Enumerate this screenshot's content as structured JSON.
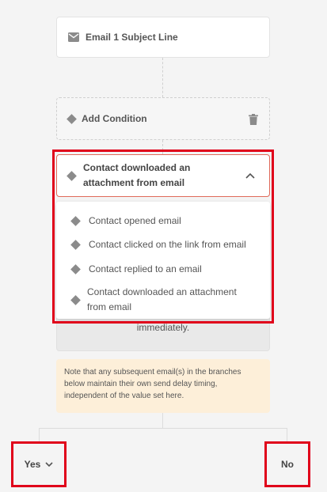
{
  "email_node": {
    "title": "Email 1 Subject Line",
    "icon": "email-icon"
  },
  "condition_node": {
    "label": "Add Condition",
    "icon": "diamond-icon",
    "action_icon": "trash-icon"
  },
  "condition_select": {
    "selected": "Contact downloaded an attachment from email",
    "selected_line1": "Contact downloaded an",
    "selected_line2": "attachment from email",
    "options": [
      {
        "label": "Contact opened email"
      },
      {
        "label": "Contact clicked on the link from email"
      },
      {
        "label": "Contact replied to an email"
      },
      {
        "label_line1": "Contact downloaded an attachment",
        "label_line2": "from email"
      }
    ]
  },
  "delay_box": {
    "text": "immediately."
  },
  "note": {
    "text": "Note that any subsequent email(s) in the branches below maintain their own send delay timing, independent of the value set here."
  },
  "branches": {
    "yes_label": "Yes",
    "no_label": "No"
  },
  "colors": {
    "accent": "#e06a5a",
    "highlight": "#e0001a",
    "note_bg": "#fdefd9"
  }
}
